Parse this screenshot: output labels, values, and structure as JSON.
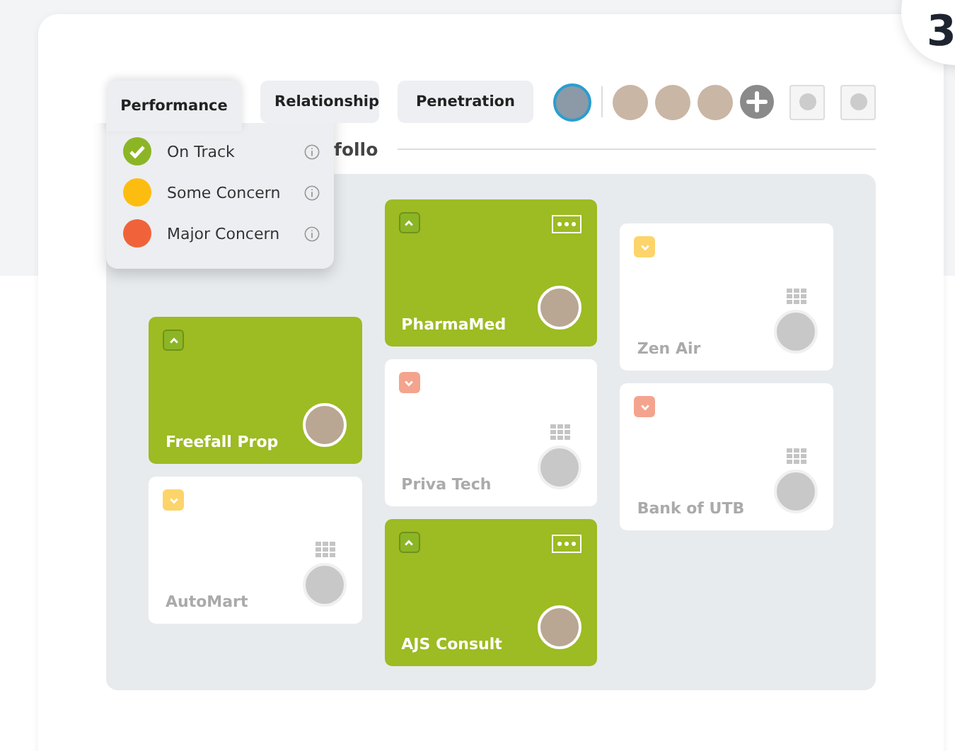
{
  "tabs": [
    {
      "label": "Performance",
      "selected": true
    },
    {
      "label": "Relationship",
      "selected": false
    },
    {
      "label": "Penetration",
      "selected": false
    }
  ],
  "legend": [
    {
      "label": "On Track",
      "color": "#8cb526",
      "selected": true
    },
    {
      "label": "Some Concern",
      "color": "#fdbd10",
      "selected": false
    },
    {
      "label": "Major Concern",
      "color": "#f0633a",
      "selected": false
    }
  ],
  "heading": "follo",
  "team": [
    {
      "selected": true
    },
    {
      "selected": false
    },
    {
      "selected": false
    },
    {
      "selected": false
    }
  ],
  "step_badge": "3",
  "columns": [
    {
      "cards": [
        {
          "name": "Freefall Prop",
          "kind": "highlighted",
          "expanded": true,
          "menu_button": false,
          "color": "#8cb526"
        },
        {
          "name": "AutoMart",
          "kind": "plain",
          "expanded": false,
          "color": "#fcd46a"
        }
      ]
    },
    {
      "cards": [
        {
          "name": "PharmaMed",
          "kind": "highlighted",
          "expanded": true,
          "menu_button": true,
          "color": "#8cb526"
        },
        {
          "name": "Priva Tech",
          "kind": "plain",
          "expanded": false,
          "color": "#f4a48e"
        },
        {
          "name": "AJS Consult",
          "kind": "highlighted",
          "expanded": true,
          "menu_button": true,
          "color": "#8cb526"
        }
      ]
    },
    {
      "cards": [
        {
          "name": "Zen Air",
          "kind": "plain",
          "expanded": false,
          "color": "#fcd46a"
        },
        {
          "name": "Bank of UTB",
          "kind": "plain",
          "expanded": false,
          "color": "#f4a48e"
        }
      ]
    }
  ]
}
